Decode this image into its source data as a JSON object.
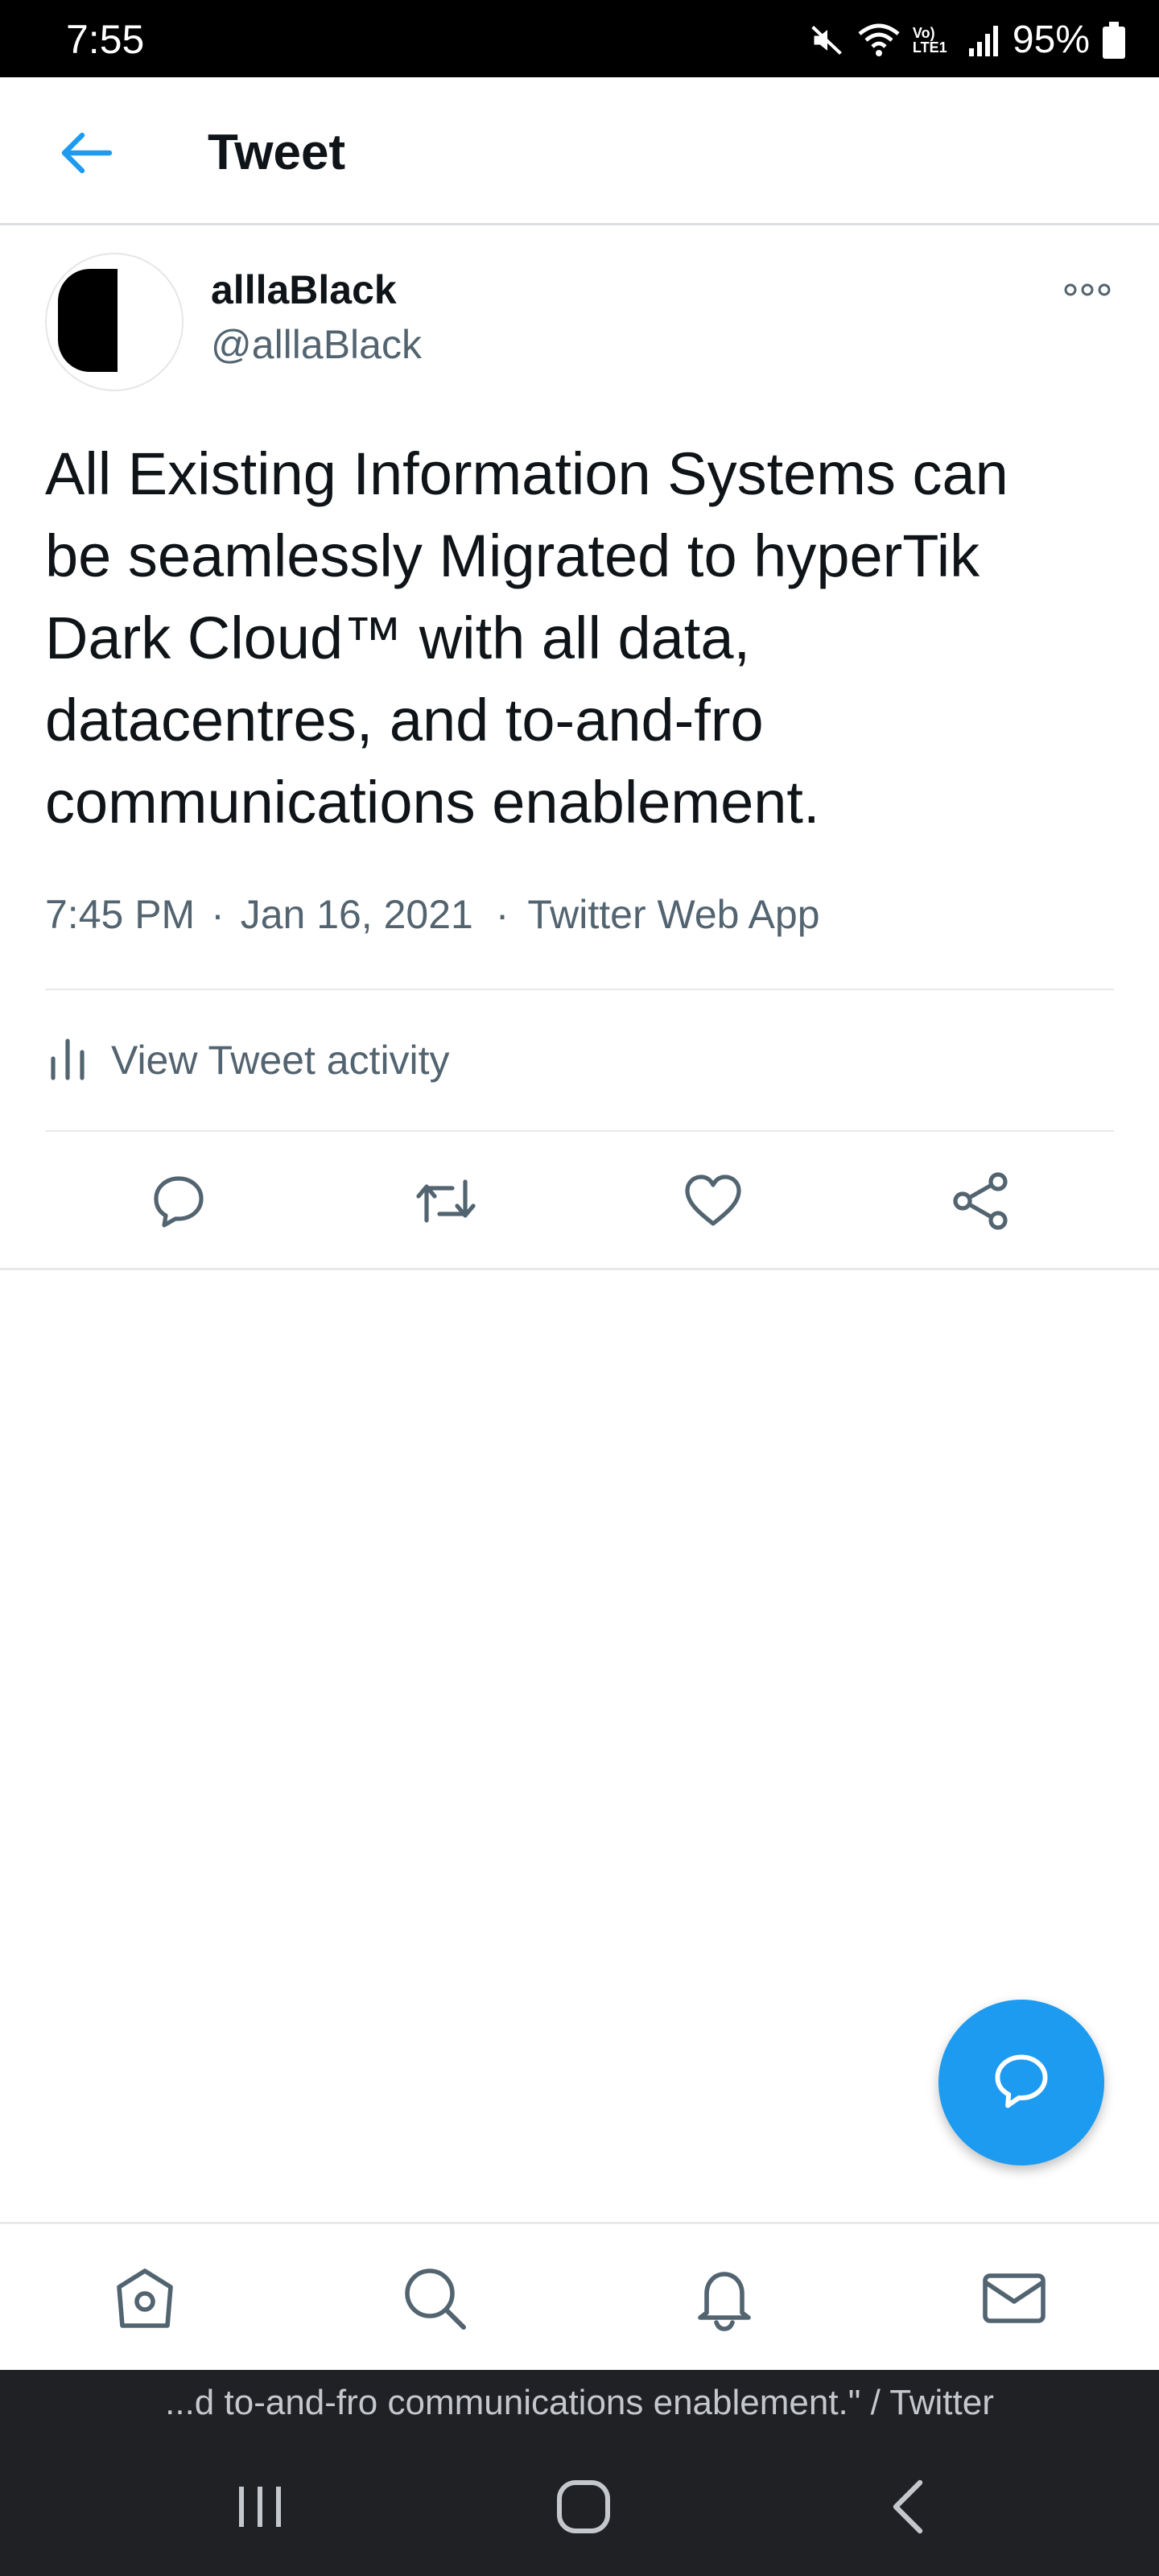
{
  "status_bar": {
    "time": "7:55",
    "battery": "95%",
    "network_label": "Vo) LTE1",
    "icons": [
      "mute-icon",
      "wifi-icon",
      "signal-icon",
      "battery-icon"
    ]
  },
  "header": {
    "title": "Tweet",
    "back_icon": "arrow-left-icon"
  },
  "tweet": {
    "display_name": "alllaBlack",
    "handle": "@alllaBlack",
    "text": "All Existing Information Systems can\nbe seamlessly Migrated to hyperTik\nDark Cloud™ with all data,\ndatacentres, and to-and-fro\ncommunications enablement.",
    "time": "7:45 PM",
    "date": "Jan 16, 2021",
    "source": "Twitter Web App",
    "separator": "·",
    "activity_label": "View Tweet activity"
  },
  "actions": [
    "reply-icon",
    "retweet-icon",
    "like-icon",
    "share-icon"
  ],
  "bottom_nav": [
    "home-icon",
    "search-icon",
    "notifications-icon",
    "messages-icon"
  ],
  "caption": {
    "text": "...d to-and-fro communications enablement.\" / Twitter"
  },
  "system_nav": [
    "recents-icon",
    "home-circle-icon",
    "back-chevron-icon"
  ],
  "colors": {
    "accent": "#1d9bf0",
    "secondary_text": "#536471",
    "primary_text": "#0f1419",
    "divider": "#e7e9eb",
    "system_bar": "#202124"
  }
}
